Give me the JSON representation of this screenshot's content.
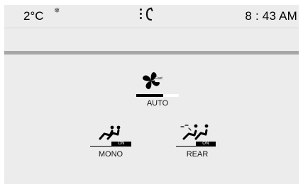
{
  "status": {
    "temperature": "2°C",
    "weather_icon": "snowflake-icon",
    "menu_icon": "vertical-dots-icon",
    "phone_icon": "phone-handset-icon",
    "time": "8 : 43 AM"
  },
  "climate": {
    "fan": {
      "icon": "fan-icon",
      "badge": "Fast",
      "level_fraction": 0.63,
      "mode_label": "AUTO"
    },
    "mono": {
      "icon": "seat-occupants-icon",
      "state": "ON",
      "label": "MONO"
    },
    "rear": {
      "icon": "rear-seat-occupants-icon",
      "state": "ON",
      "label": "REAR"
    }
  },
  "colors": {
    "panel": "#ececec",
    "separator": "#a7a7a7",
    "text": "#111111",
    "on_badge": "#000000"
  }
}
